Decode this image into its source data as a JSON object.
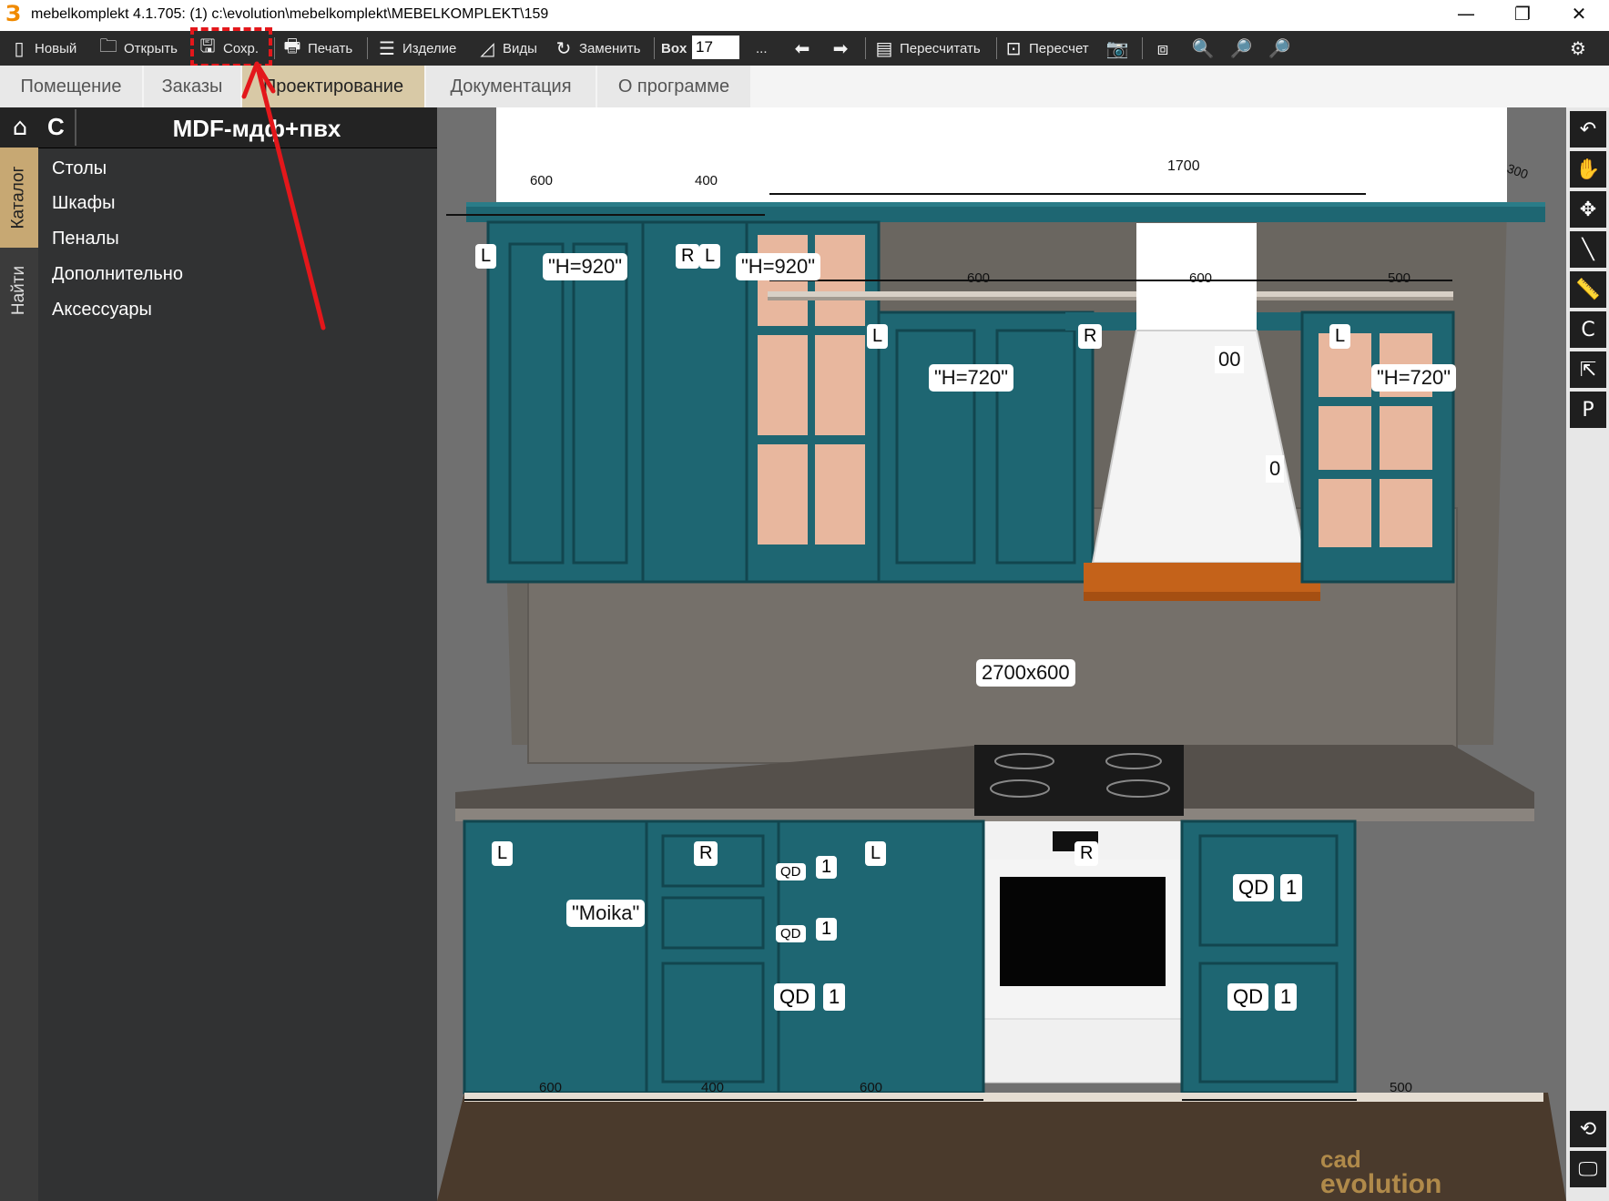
{
  "window": {
    "title": "mebelkomplekt 4.1.705: (1)  c:\\evolution\\mebelkomplekt\\MEBELKOMPLEKT\\159",
    "minimize": "—",
    "restore": "❐",
    "close": "✕"
  },
  "toolbar": {
    "new": "Новый",
    "open": "Открыть",
    "save": "Сохр.",
    "print": "Печать",
    "product": "Изделие",
    "views": "Виды",
    "replace": "Заменить",
    "box_label": "Box",
    "box_value": "17",
    "more": "...",
    "recalc": "Пересчитать",
    "recount": "Пересчет"
  },
  "tabs": [
    "Помещение",
    "Заказы",
    "Проектирование",
    "Документация",
    "О программе"
  ],
  "active_tab": "Проектирование",
  "panel": {
    "home_label": "C",
    "title": "MDF-мдф+пвх",
    "vtab_catalog": "Каталог",
    "vtab_find": "Найти",
    "items": [
      "Столы",
      "Шкафы",
      "Пеналы",
      "Дополнительно",
      "Аксессуары"
    ]
  },
  "scene": {
    "dims_top": [
      "600",
      "400",
      "1700",
      "300"
    ],
    "dims_shelf": [
      "600",
      "600",
      "500"
    ],
    "dims_bottom": [
      "600",
      "400",
      "600",
      "500"
    ],
    "tag_h920": "\"H=920\"",
    "tag_h720": "\"H=720\"",
    "tag_moika": "\"Moika\"",
    "tag_apron": "2700x600",
    "tag_L": "L",
    "tag_R": "R",
    "tag_qd": "QD",
    "tag_one": "1",
    "partial_00": "00",
    "partial_0": "0",
    "watermark_cad": "cad",
    "watermark_evolution": "evolution"
  },
  "colors": {
    "accent_tab": "#d8c9a6",
    "highlight": "#e3171b",
    "cabinet": "#1e6672",
    "toolbar_bg": "#2a2a2a"
  }
}
